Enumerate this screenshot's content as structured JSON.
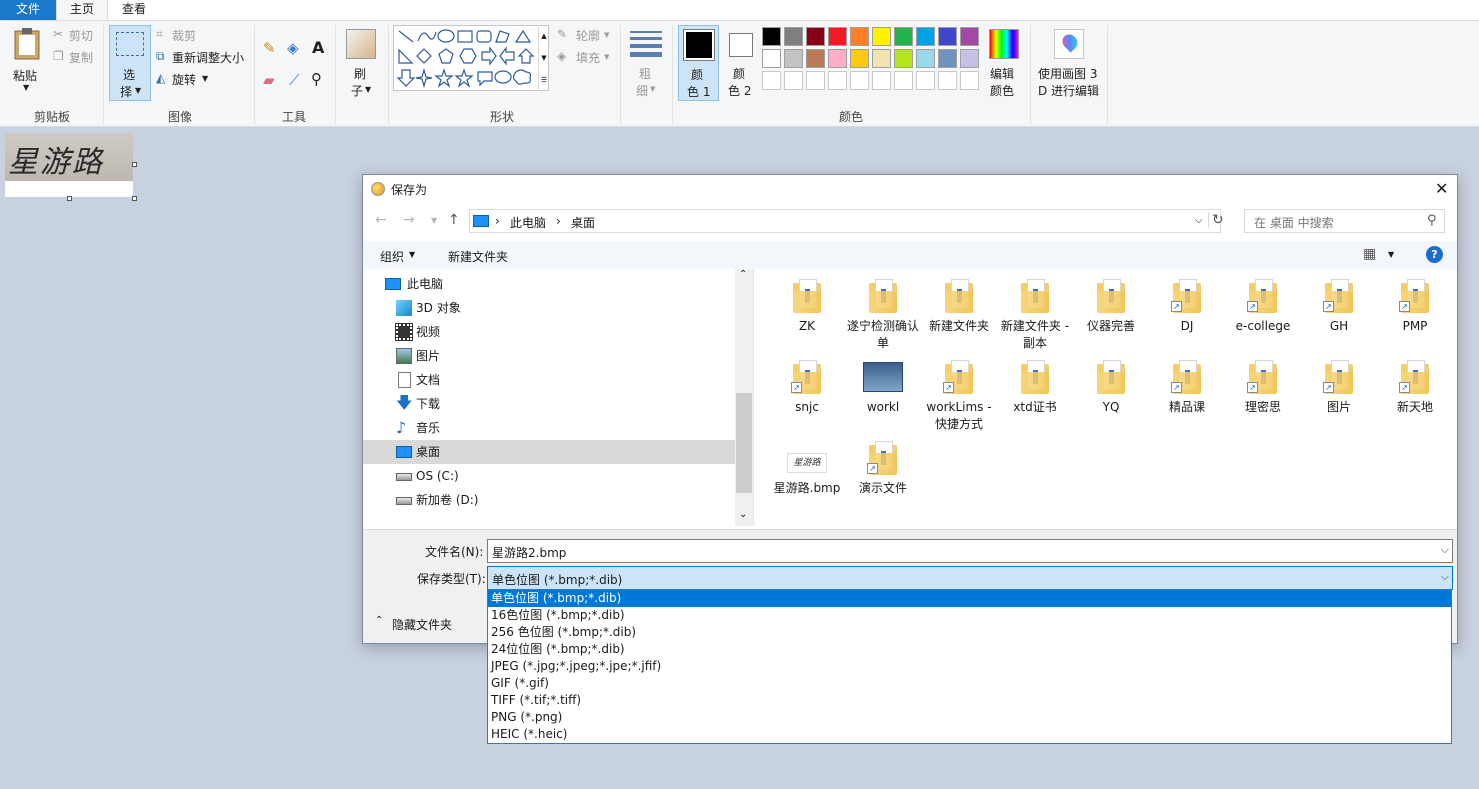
{
  "tabs": [
    "文件",
    "主页",
    "查看"
  ],
  "ribbon": {
    "clipboard": {
      "paste": "粘贴",
      "cut": "剪切",
      "copy": "复制",
      "group": "剪贴板"
    },
    "image": {
      "select_line1": "选",
      "select_line2": "择",
      "crop": "裁剪",
      "resize": "重新调整大小",
      "rotate": "旋转",
      "group": "图像"
    },
    "tools": {
      "group": "工具"
    },
    "brush": {
      "line1": "刷",
      "line2": "子"
    },
    "shapes": {
      "outline": "轮廓",
      "fill": "填充",
      "group": "形状"
    },
    "size": {
      "line1": "粗",
      "line2": "细"
    },
    "color1": {
      "line1": "颜",
      "line2": "色 1"
    },
    "color2": {
      "line1": "颜",
      "line2": "色 2"
    },
    "colors_group": "颜色",
    "edit_colors": {
      "line1": "编辑",
      "line2": "颜色"
    },
    "paint3d": {
      "line1": "使用画图 3",
      "line2": "D 进行编辑"
    },
    "palette_row1": [
      "#000000",
      "#7f7f7f",
      "#880015",
      "#ed1c24",
      "#ff7f27",
      "#fff200",
      "#22b14c",
      "#00a2e8",
      "#3f48cc",
      "#a349a4"
    ],
    "palette_row2": [
      "#ffffff",
      "#c3c3c3",
      "#b97a57",
      "#ffaec9",
      "#ffc90e",
      "#efe4b0",
      "#b5e61d",
      "#99d9ea",
      "#7092be",
      "#c8bfe7"
    ]
  },
  "canvas": {
    "text": "星游路"
  },
  "dialog": {
    "title": "保存为",
    "breadcrumb": [
      "此电脑",
      "桌面"
    ],
    "search_placeholder": "在 桌面 中搜索",
    "organize": "组织",
    "new_folder": "新建文件夹",
    "help": "?",
    "nav": [
      "此电脑",
      "3D 对象",
      "视频",
      "图片",
      "文档",
      "下载",
      "音乐",
      "桌面",
      "OS (C:)",
      "新加卷 (D:)"
    ],
    "files": [
      {
        "name": "ZK"
      },
      {
        "name": "遂宁检测确认单"
      },
      {
        "name": "新建文件夹"
      },
      {
        "name": "新建文件夹 - 副本"
      },
      {
        "name": "仪器完善"
      },
      {
        "name": "DJ"
      },
      {
        "name": "e-college"
      },
      {
        "name": "GH"
      },
      {
        "name": "PMP"
      },
      {
        "name": "snjc"
      },
      {
        "name": "workl"
      },
      {
        "name": "workLims - 快捷方式"
      },
      {
        "name": "xtd证书"
      },
      {
        "name": "YQ"
      },
      {
        "name": "精品课"
      },
      {
        "name": "理密思"
      },
      {
        "name": "图片"
      },
      {
        "name": "新天地"
      },
      {
        "name": "星游路.bmp"
      },
      {
        "name": "演示文件"
      }
    ],
    "filename_label": "文件名(N):",
    "filename_value": "星游路2.bmp",
    "filetype_label": "保存类型(T):",
    "filetype_value": "单色位图 (*.bmp;*.dib)",
    "hide_folders": "隐藏文件夹"
  },
  "filetype_options": [
    "单色位图 (*.bmp;*.dib)",
    "16色位图 (*.bmp;*.dib)",
    "256 色位图 (*.bmp;*.dib)",
    "24位位图 (*.bmp;*.dib)",
    "JPEG (*.jpg;*.jpeg;*.jpe;*.jfif)",
    "GIF (*.gif)",
    "TIFF (*.tif;*.tiff)",
    "PNG (*.png)",
    "HEIC (*.heic)"
  ]
}
